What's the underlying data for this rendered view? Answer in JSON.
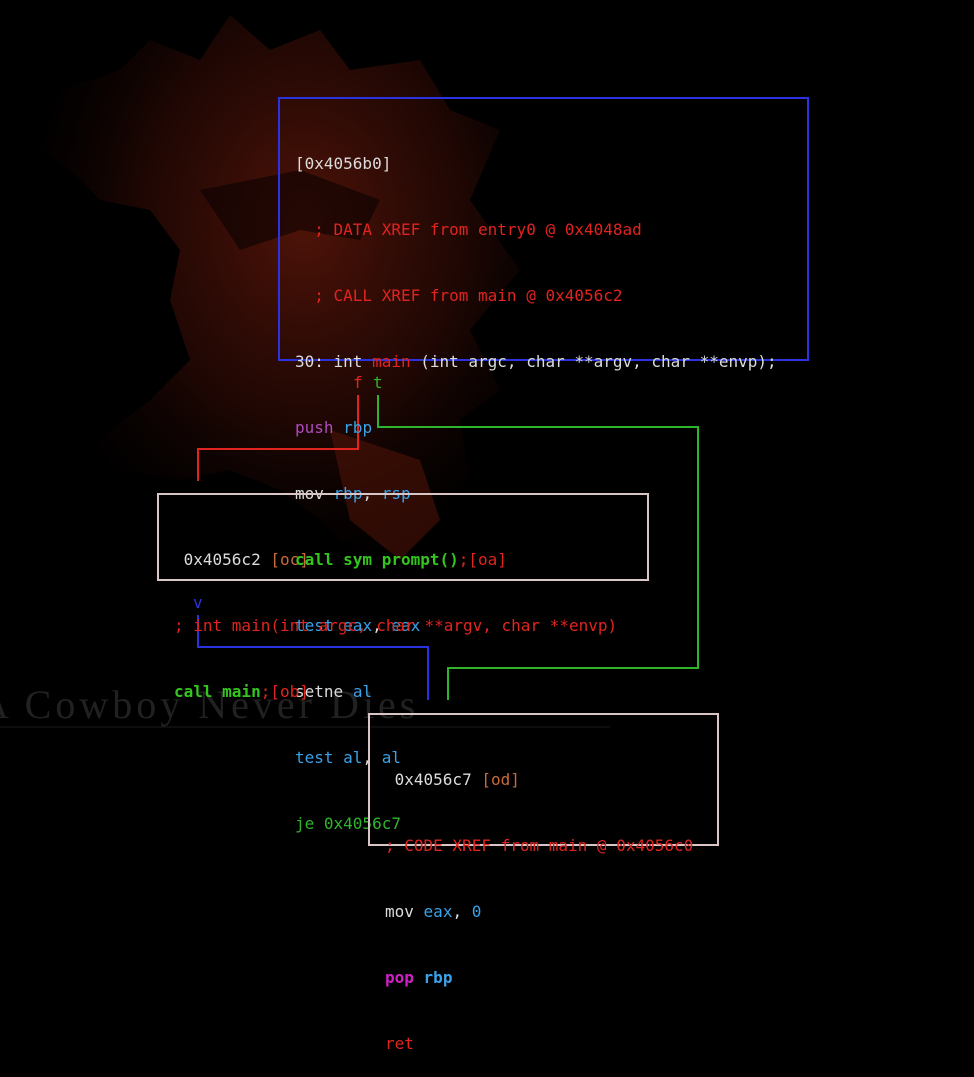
{
  "node_main": {
    "addr": "[0x4056b0]",
    "xref1": "  ; DATA XREF from entry0 @ 0x4048ad",
    "xref2": "  ; CALL XREF from main @ 0x4056c2",
    "sig_prefix": "30: int ",
    "sig_name": "main",
    "sig_rest": " (int argc, char **argv, char **envp);",
    "i1_op": "push",
    "i1_a": "rbp",
    "i2_op": "mov",
    "i2_a": "rbp",
    "i2_sep": ", ",
    "i2_b": "rsp",
    "i3_op": "call sym prompt()",
    "i3_tag": ";[oa]",
    "i4_op": "test",
    "i4_a": "eax",
    "i4_sep": ", ",
    "i4_b": "eax",
    "i5_op": "setne",
    "i5_a": "al",
    "i6_op": "test",
    "i6_a": "al",
    "i6_sep": ", ",
    "i6_b": "al",
    "i7": "je 0x4056c7"
  },
  "node_c2": {
    "addr": " 0x4056c2",
    "tag": "[oc]",
    "comment": "; int main(int argc, char **argv, char **envp)",
    "call_op": "call main",
    "call_tag": ";[ob]"
  },
  "node_c7": {
    "addr": " 0x4056c7",
    "tag": "[od]",
    "xref": "; CODE XREF from main @ 0x4056c0",
    "i1_op": "mov",
    "i1_a": "eax",
    "i1_sep": ", ",
    "i1_b": "0",
    "i2_op": "pop",
    "i2_a": "rbp",
    "i3": "ret"
  },
  "edge_labels": {
    "false": "f",
    "true": "t",
    "next": "v"
  },
  "wallpaper_text": "A Cowboy Never Dies",
  "colors": {
    "background": "#000000",
    "main_border": "#2b33e0",
    "node_border": "#d8c6c6",
    "edge_false": "#e1241f",
    "edge_true": "#2fb52c",
    "edge_next": "#2b33e0"
  }
}
